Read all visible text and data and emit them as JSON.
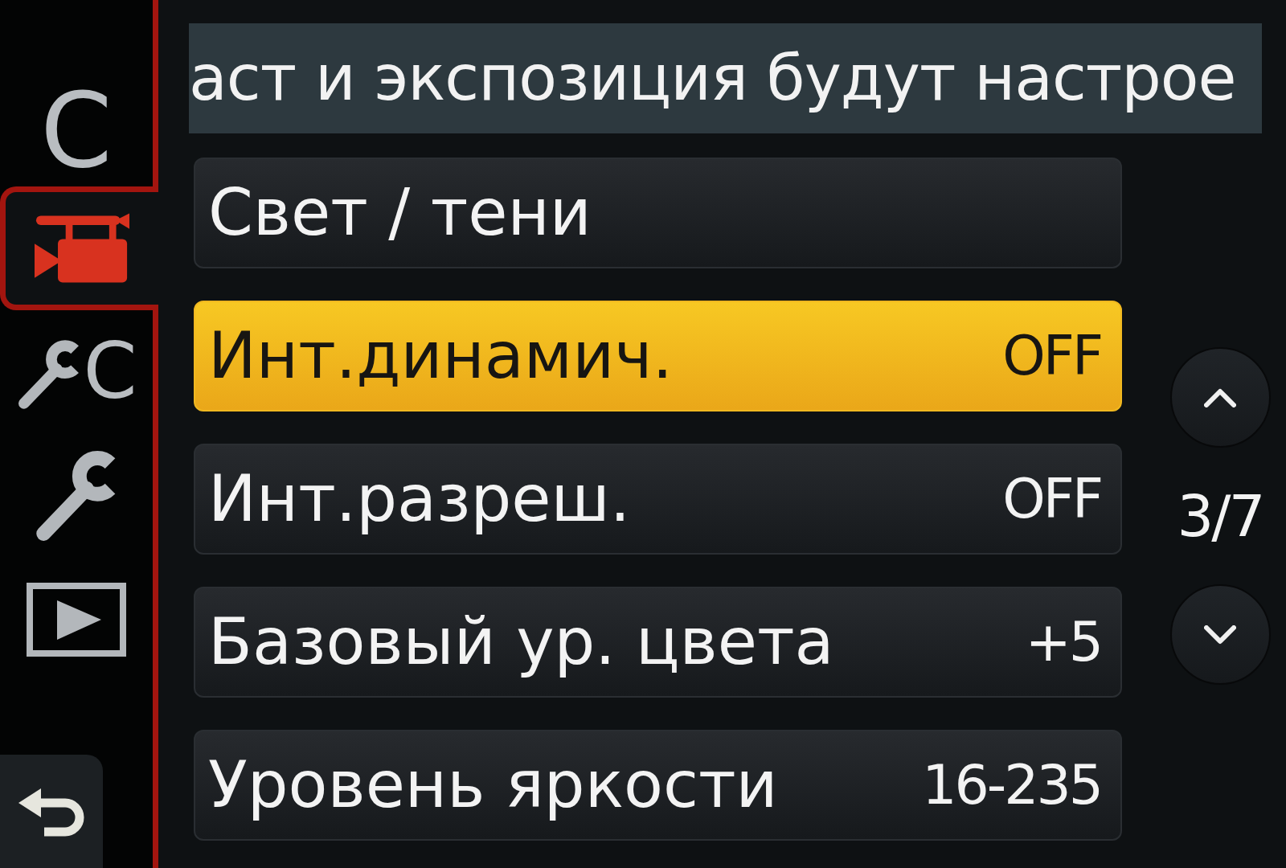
{
  "menu_tabs": [
    {
      "kind": "letter",
      "glyph": "C",
      "selected": false
    },
    {
      "kind": "video",
      "selected": true
    },
    {
      "kind": "wrench_letter",
      "glyph": "C",
      "selected": false
    },
    {
      "kind": "wrench",
      "selected": false
    },
    {
      "kind": "playback",
      "selected": false
    }
  ],
  "help_text": "аст и экспозиция будут настрое",
  "menu_items": [
    {
      "label": "Свет / тени",
      "selected": false
    },
    {
      "label": "Инт.динамич.",
      "value": "OFF",
      "selected": true
    },
    {
      "label": "Инт.разреш.",
      "value": "OFF",
      "selected": false
    },
    {
      "label": "Базовый ур. цвета",
      "value": "+5",
      "selected": false
    },
    {
      "label": "Уровень яркости",
      "value": "16-235",
      "selected": false
    }
  ],
  "page_indicator": "3/7"
}
